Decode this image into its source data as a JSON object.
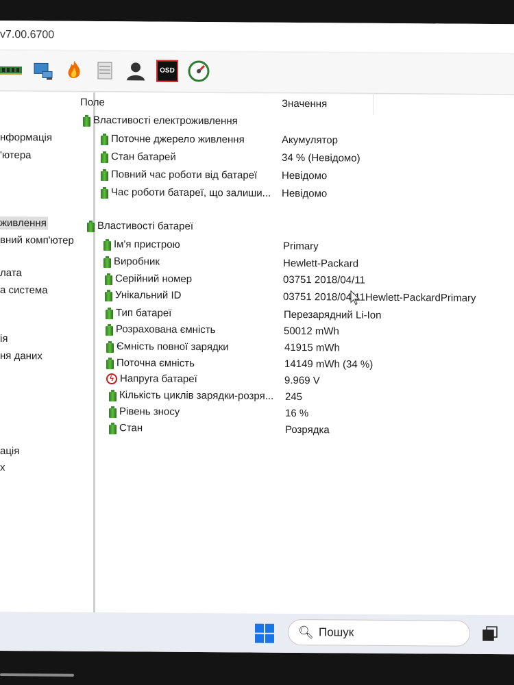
{
  "window": {
    "title": "v7.00.6700"
  },
  "toolbar": {
    "icons": [
      "memory-icon",
      "network-icon",
      "flame-icon",
      "server-icon",
      "user-icon",
      "osd-icon",
      "gauge-icon"
    ],
    "osd_label": "OSD"
  },
  "sidebar": {
    "items": [
      {
        "label": "нформація"
      },
      {
        "label": "'ютера"
      },
      {
        "label": "живлення",
        "selected": true
      },
      {
        "label": "вний комп'ютер"
      },
      {
        "label": "лата"
      },
      {
        "label": "а система"
      },
      {
        "label": "ія"
      },
      {
        "label": "ня даних"
      },
      {
        "label": "ація"
      },
      {
        "label": "х"
      }
    ]
  },
  "table": {
    "headers": {
      "field": "Поле",
      "value": "Значення"
    },
    "groups": [
      {
        "title": "Властивості електроживлення",
        "rows": [
          {
            "field": "Поточне джерело живлення",
            "value": "Акумулятор"
          },
          {
            "field": "Стан батарей",
            "value": "34 % (Невідомо)"
          },
          {
            "field": "Повний час роботи від батареї",
            "value": "Невідомо"
          },
          {
            "field": "Час роботи батареї, що залиши...",
            "value": "Невідомо"
          }
        ]
      },
      {
        "title": "Властивості батареї",
        "rows": [
          {
            "field": "Ім'я пристрою",
            "value": "Primary"
          },
          {
            "field": "Виробник",
            "value": "Hewlett-Packard"
          },
          {
            "field": "Серійний номер",
            "value": "03751 2018/04/11"
          },
          {
            "field": "Унікальний ID",
            "value": "03751 2018/04/11Hewlett-PackardPrimary"
          },
          {
            "field": "Тип батареї",
            "value": "Перезарядний Li-Ion"
          },
          {
            "field": "Розрахована ємність",
            "value": "50012 mWh"
          },
          {
            "field": "Ємність повної зарядки",
            "value": "41915 mWh"
          },
          {
            "field": "Поточна ємність",
            "value": "14149 mWh  (34 %)"
          },
          {
            "field": "Напруга батареї",
            "value": "9.969 V",
            "icon": "voltage-icon"
          },
          {
            "field": "Кількість циклів зарядки-розря...",
            "value": "245"
          },
          {
            "field": "Рівень зносу",
            "value": "16 %"
          },
          {
            "field": "Стан",
            "value": "Розрядка"
          }
        ]
      }
    ]
  },
  "taskbar": {
    "search_label": "Пошук"
  }
}
